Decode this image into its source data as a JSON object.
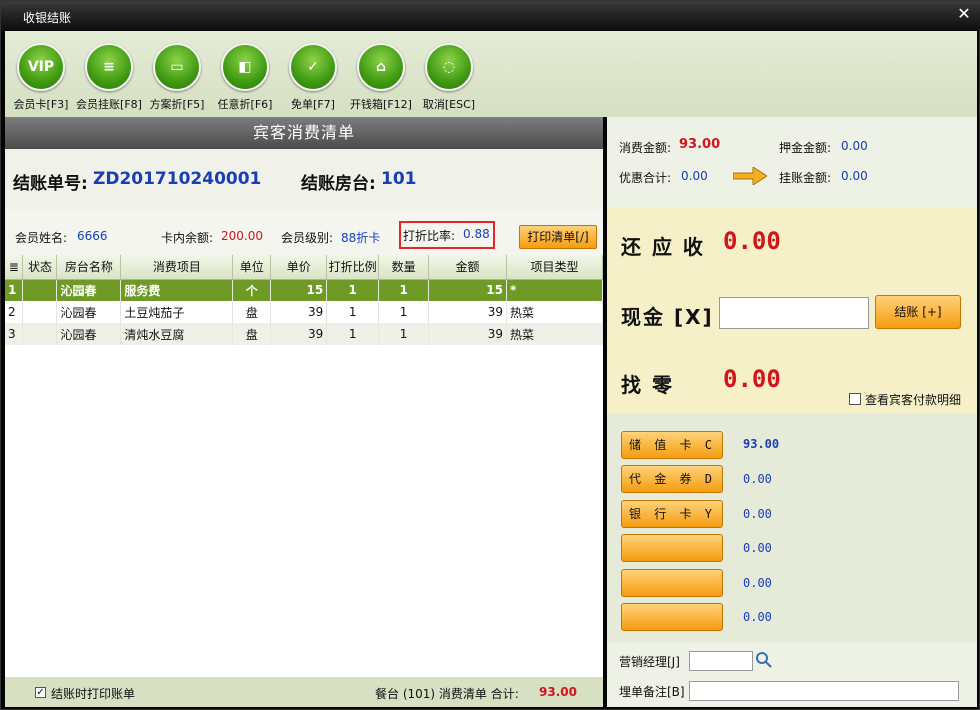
{
  "window": {
    "title": "收银结账",
    "close": "✕"
  },
  "toolbar": [
    {
      "icon": "vip-card-icon",
      "glyph": "VIP",
      "label": "会员卡[F3]"
    },
    {
      "icon": "member-credit-icon",
      "glyph": "≡",
      "label": "会员挂账[F8]"
    },
    {
      "icon": "scheme-discount-icon",
      "glyph": "▭",
      "label": "方案折[F5]"
    },
    {
      "icon": "free-discount-icon",
      "glyph": "◧",
      "label": "任意折[F6]"
    },
    {
      "icon": "free-order-icon",
      "glyph": "✓",
      "label": "免单[F7]"
    },
    {
      "icon": "cash-drawer-icon",
      "glyph": "⌂",
      "label": "开钱箱[F12]"
    },
    {
      "icon": "cancel-icon",
      "glyph": "◌",
      "label": "取消[ESC]"
    }
  ],
  "bill": {
    "header": "宾客消费清单",
    "no_label": "结账单号:",
    "no_value": "ZD201710240001",
    "room_label": "结账房台:",
    "room_value": "101",
    "member_name_label": "会员姓名:",
    "member_name": "6666",
    "card_balance_label": "卡内余额:",
    "card_balance": "200.00",
    "member_level_label": "会员级别:",
    "member_level": "88折卡",
    "discount_label": "打折比率:",
    "discount_value": "0.88",
    "print_button": "打印清单[/]",
    "columns": [
      "状态",
      "房台名称",
      "消费项目",
      "单位",
      "单价",
      "打折比例",
      "数量",
      "金额",
      "项目类型"
    ],
    "rows": [
      {
        "idx": "1",
        "status": "",
        "room": "沁园春",
        "item": "服务费",
        "unit": "个",
        "price": "15",
        "ratio": "1",
        "qty": "1",
        "amount": "15",
        "type": "*"
      },
      {
        "idx": "2",
        "status": "",
        "room": "沁园春",
        "item": "土豆炖茄子",
        "unit": "盘",
        "price": "39",
        "ratio": "1",
        "qty": "1",
        "amount": "39",
        "type": "热菜"
      },
      {
        "idx": "3",
        "status": "",
        "room": "沁园春",
        "item": "清炖水豆腐",
        "unit": "盘",
        "price": "39",
        "ratio": "1",
        "qty": "1",
        "amount": "39",
        "type": "热菜"
      }
    ],
    "footer_print_label": "结账时打印账单",
    "footer_summary": "餐台 (101) 消费清单 合计:",
    "footer_total": "93.00"
  },
  "summary": {
    "consume_label": "消费金额:",
    "consume_value": "93.00",
    "deposit_label": "押金金额:",
    "deposit_value": "0.00",
    "discount_total_label": "优惠合计:",
    "discount_total_value": "0.00",
    "credit_label": "挂账金额:",
    "credit_value": "0.00"
  },
  "payment": {
    "due_label": "还 应 收",
    "due_value": "0.00",
    "cash_label": "现金 [X]",
    "cash_input": "",
    "settle_button": "结账 [+]",
    "change_label": "找   零",
    "change_value": "0.00",
    "detail_check_label": "查看宾客付款明细",
    "methods": [
      {
        "label": "储 值 卡 C",
        "value": "93.00"
      },
      {
        "label": "代 金 券 D",
        "value": "0.00"
      },
      {
        "label": "银 行 卡 Y",
        "value": "0.00"
      },
      {
        "label": "",
        "value": "0.00"
      },
      {
        "label": "",
        "value": "0.00"
      },
      {
        "label": "",
        "value": "0.00"
      }
    ],
    "manager_label": "营销经理[J]",
    "manager_value": "",
    "remark_label": "埋单备注[B]",
    "remark_value": ""
  },
  "colors": {
    "accent_green": "#6e9a25",
    "orange": "#f59c0f",
    "red": "#d2141c",
    "blue": "#1a3fb5"
  }
}
